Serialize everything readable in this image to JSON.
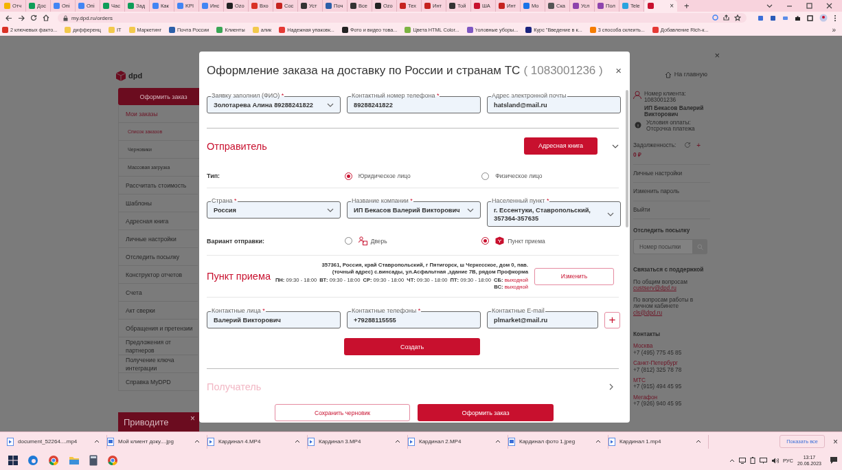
{
  "browser": {
    "tabs": [
      {
        "label": "Отч",
        "color": "#f4b400",
        "selected": false
      },
      {
        "label": "Дос",
        "color": "#0f9d58",
        "selected": false
      },
      {
        "label": "Опі",
        "color": "#4285f4",
        "selected": false
      },
      {
        "label": "Опі",
        "color": "#4285f4",
        "selected": false
      },
      {
        "label": "Час",
        "color": "#0f9d58",
        "selected": false
      },
      {
        "label": "Зад",
        "color": "#0f9d58",
        "selected": false
      },
      {
        "label": "Как",
        "color": "#4285f4",
        "selected": false
      },
      {
        "label": "KPI",
        "color": "#4285f4",
        "selected": false
      },
      {
        "label": "Инс",
        "color": "#4285f4",
        "selected": false
      },
      {
        "label": "Ozo",
        "color": "#222222",
        "selected": false
      },
      {
        "label": "Вхо",
        "color": "#d93025",
        "selected": false
      },
      {
        "label": "Сос",
        "color": "#c5221f",
        "selected": false
      },
      {
        "label": "Уст",
        "color": "#333333",
        "selected": false
      },
      {
        "label": "Поч",
        "color": "#2c5fa8",
        "selected": false
      },
      {
        "label": "Все",
        "color": "#333333",
        "selected": false
      },
      {
        "label": "Ozo",
        "color": "#222222",
        "selected": false
      },
      {
        "label": "Тех",
        "color": "#c5221f",
        "selected": false
      },
      {
        "label": "Инт",
        "color": "#c5221f",
        "selected": false
      },
      {
        "label": "Той",
        "color": "#333333",
        "selected": false
      },
      {
        "label": "ША",
        "color": "#c8102e",
        "selected": false
      },
      {
        "label": "Инт",
        "color": "#c5221f",
        "selected": false
      },
      {
        "label": "Мо",
        "color": "#1a73e8",
        "selected": false
      },
      {
        "label": "Ска",
        "color": "#555555",
        "selected": false
      },
      {
        "label": "Усл",
        "color": "#8e44ad",
        "selected": false
      },
      {
        "label": "Пол",
        "color": "#8e44ad",
        "selected": false
      },
      {
        "label": "Tele",
        "color": "#2aa3df",
        "selected": false
      },
      {
        "color": "#c8102e",
        "selected": true,
        "close": "×"
      }
    ],
    "new_tab": "+",
    "address": "my.dpd.ru/orders",
    "bookmarks": [
      {
        "label": "2 ключевых факто...",
        "color": "#d93025"
      },
      {
        "label": "дифференц",
        "color": "#f2c94c"
      },
      {
        "label": "IT",
        "color": "#f2c94c"
      },
      {
        "label": "Маркетинг",
        "color": "#f2c94c"
      },
      {
        "label": "Почта России",
        "color": "#2c5fa8"
      },
      {
        "label": "Клиенты",
        "color": "#3aa655"
      },
      {
        "label": "алик",
        "color": "#f2c94c"
      },
      {
        "label": "Надежная упаковк...",
        "color": "#e53935"
      },
      {
        "label": "Фото и видео това...",
        "color": "#222222"
      },
      {
        "label": "Цвета HTML Color...",
        "color": "#7cb342"
      },
      {
        "label": "'головные уборы...",
        "color": "#7e57c2"
      },
      {
        "label": "Курс \"Введение в к...",
        "color": "#1a237e"
      },
      {
        "label": "3 способа склеить...",
        "color": "#f57c00"
      },
      {
        "label": "Добавление Rich-к...",
        "color": "#e53935"
      }
    ],
    "bookmarks_more": "»"
  },
  "sidebar": {
    "logo": "dpd",
    "order_button": "Оформить заказ",
    "items": [
      {
        "label": "Мои заказы",
        "selected": true,
        "children": [
          {
            "label": "Список заказов",
            "selected": true
          },
          {
            "label": "Черновики",
            "selected": false
          },
          {
            "label": "Массовая загрузка",
            "selected": false
          }
        ]
      },
      {
        "label": "Рассчитать стоимость",
        "selected": false
      },
      {
        "label": "Шаблоны",
        "selected": false
      },
      {
        "label": "Адресная книга",
        "selected": false
      },
      {
        "label": "Личные настройки",
        "selected": false
      },
      {
        "label": "Отследить посылку",
        "selected": false
      },
      {
        "label": "Конструктор отчетов",
        "selected": false
      },
      {
        "label": "Счета",
        "selected": false
      },
      {
        "label": "Акт сверки",
        "selected": false
      },
      {
        "label": "Обращения и претензии",
        "selected": false
      },
      {
        "label": "Предложения от партнеров",
        "selected": false
      },
      {
        "label": "Получение ключа интеграции",
        "selected": false
      },
      {
        "label": "Справка MyDPD",
        "selected": false
      }
    ],
    "promo": {
      "text": "Приводите",
      "close": "×"
    }
  },
  "account": {
    "close": "×",
    "home": "На главную",
    "client_label": "Номер клиента:",
    "client_number": "1083001236",
    "client_name": "ИП Бекасов Валерий Викторович",
    "payment_label": "Условия оплаты:",
    "payment_value": "Отсрочка платежа",
    "debt_label": "Задолженность:",
    "debt_add": "+",
    "debt_value": "0 ₽",
    "links": [
      "Личные настройки",
      "Изменить пароль",
      "Выйти"
    ],
    "track": {
      "title": "Отследить посылку",
      "placeholder": "Номер посылки"
    },
    "support": {
      "title": "Связаться с поддержкой",
      "items": [
        {
          "text": "По общим вопросам",
          "email": "custserv@dpd.ru"
        },
        {
          "text": "По вопросам работы в личном кабинете",
          "email": "cls@dpd.ru"
        }
      ]
    },
    "contacts": {
      "title": "Контакты",
      "items": [
        {
          "city": "Москва",
          "phone": "+7 (495) 775 45 85"
        },
        {
          "city": "Санкт-Петербург",
          "phone": "+7 (812) 325 78 78"
        },
        {
          "city": "МТС",
          "phone": "+7 (915) 494 45 95"
        },
        {
          "city": "Мегафон",
          "phone": "+7 (926) 940 45 95"
        }
      ]
    }
  },
  "modal": {
    "title": "Оформление заказа на доставку по России и странам ТС",
    "order_number": "( 1083001236 )",
    "close": "×",
    "top_fields": [
      {
        "label": "Заявку заполнил (ФИО)",
        "mark": "*",
        "value": "Золотарева Алина 89288241822",
        "kind": "select"
      },
      {
        "label": "Контактный номер телефона",
        "mark": "*",
        "value": "89288241822",
        "kind": "text"
      },
      {
        "label": "Адрес электронной почты",
        "value": "hatsland@mail.ru",
        "kind": "text"
      }
    ],
    "sender": {
      "title": "Отправитель",
      "address_book": "Адресная книга",
      "expanded": true,
      "type": {
        "label": "Тип:",
        "options": [
          {
            "label": "Юридическое лицо",
            "selected": true
          },
          {
            "label": "Физическое лицо",
            "selected": false
          }
        ]
      },
      "fields": [
        {
          "label": "Страна",
          "mark": "*",
          "value": "Россия",
          "kind": "select"
        },
        {
          "label": "Название компании",
          "mark": "*",
          "value": "ИП Бекасов Валерий Викторович",
          "kind": "select"
        },
        {
          "label": "Населенный пункт",
          "mark": "*",
          "value": "г. Ессентуки, Ставропольский, 357364-357635",
          "kind": "select"
        }
      ],
      "method": {
        "label": "Вариант отправки:",
        "options": [
          {
            "label": "Дверь",
            "selected": false,
            "kind": "door"
          },
          {
            "label": "Пункт приема",
            "selected": true,
            "kind": "pickup"
          }
        ]
      },
      "pickup": {
        "title": "Пункт приема",
        "address_lines": [
          "357361, Россия, край Ставропольский, г Пятигорск, ш Черкесское, дом 0, пав.",
          "(точный адрес) с.винсады, ул.Асфальтная ,здание 7В, рядом Профкорма"
        ],
        "hours": [
          {
            "day": "ПН:",
            "time": "09:30 - 18:00",
            "kind": "open"
          },
          {
            "day": "ВТ:",
            "time": "09:30 - 18:00",
            "kind": "open"
          },
          {
            "day": "СР:",
            "time": "09:30 - 18:00",
            "kind": "open"
          },
          {
            "day": "ЧТ:",
            "time": "09:30 - 18:00",
            "kind": "open"
          },
          {
            "day": "ПТ:",
            "time": "09:30 - 18:00",
            "kind": "open"
          },
          {
            "day": "СБ:",
            "time": "выходной",
            "kind": "closed"
          },
          {
            "day": "ВС:",
            "time": "выходной",
            "kind": "closed"
          }
        ],
        "change": "Изменить"
      },
      "contact_fields": [
        {
          "label": "Контактные лица",
          "mark": "*",
          "value": "Валерий Викторович"
        },
        {
          "label": "Контактные телефоны",
          "mark": "*",
          "value": "+79288115555"
        },
        {
          "label": "Контактные E-mail",
          "value": "plmarket@mail.ru"
        }
      ],
      "add": "+",
      "create": "Создать"
    },
    "recipient": {
      "title": "Получатель",
      "expanded": false,
      "disabled": true
    },
    "actions": {
      "draft": "Сохранить черновик",
      "submit": "Оформить заказ"
    }
  },
  "downloads": {
    "items": [
      {
        "name": "document_52264....mp4",
        "kind": "video"
      },
      {
        "name": "Мой клиент доку....jpg",
        "kind": "image"
      },
      {
        "name": "Кардинал 4.MP4",
        "kind": "video"
      },
      {
        "name": "Кардинал 3.MP4",
        "kind": "video"
      },
      {
        "name": "Кардинал 2.MP4",
        "kind": "video"
      },
      {
        "name": "Кардинал фото 1.jpeg",
        "kind": "image"
      },
      {
        "name": "Кардинал 1.mp4",
        "kind": "video"
      }
    ],
    "show_all": "Показать все",
    "close": "×"
  },
  "taskbar": {
    "language": "РУС",
    "time": "13:17",
    "date": "20.06.2023"
  }
}
